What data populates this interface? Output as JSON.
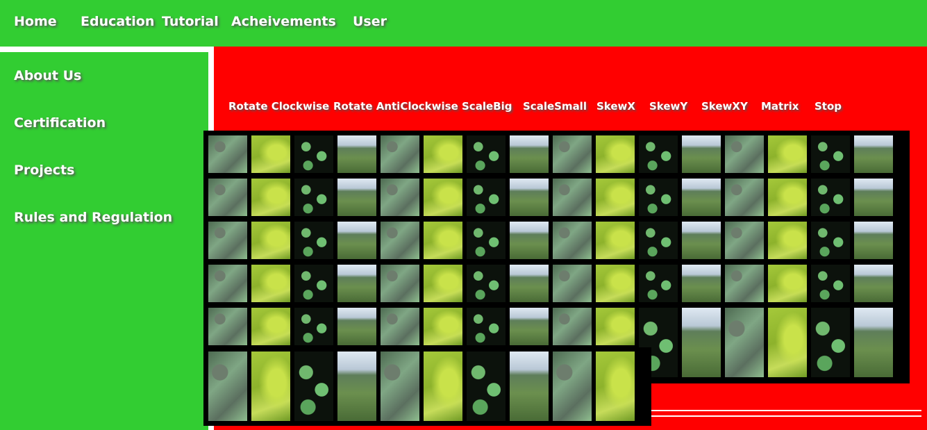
{
  "top_nav": {
    "items": [
      "Home",
      "Education",
      "Tutorial",
      "Acheivements",
      "User"
    ]
  },
  "sidebar": {
    "items": [
      "About Us",
      "Certification",
      "Projects",
      "Rules and Regulation"
    ]
  },
  "toolbar": {
    "buttons": [
      "Rotate Clockwise",
      "Rotate AntiClockwise",
      "ScaleBig",
      "ScaleSmall",
      "SkewX",
      "SkewY",
      "SkewXY",
      "Matrix",
      "Stop"
    ]
  },
  "colors": {
    "nav_green": "#32cd32",
    "content_red": "#ff0000",
    "grid_border": "#000000",
    "text": "#ffffff"
  },
  "gallery": {
    "image_cycle": [
      "spider-web-leaf",
      "green-leaf-closeup",
      "dark-leaves",
      "hillside-landscape"
    ],
    "rows_in_back_grid": 5,
    "tiles_per_row_back_grid": 16,
    "tiles_in_front_grid": 10
  }
}
